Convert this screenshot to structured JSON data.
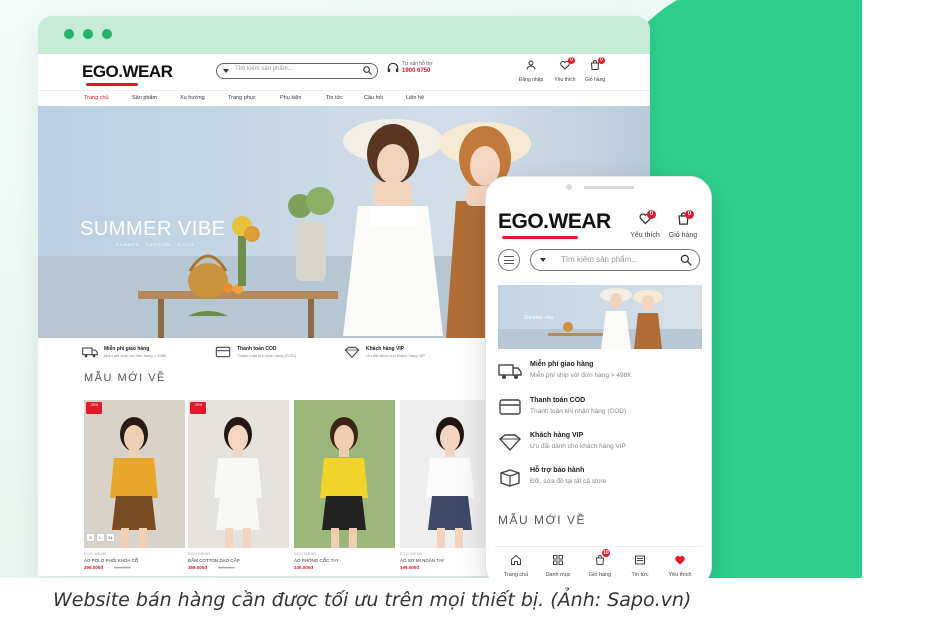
{
  "colors": {
    "brand_green": "#2ecf8d",
    "accent_red": "#e01a2b",
    "chrome_green": "#c6ecd8"
  },
  "desktop": {
    "logo": "EGO.WEAR",
    "search_placeholder": "Tìm kiếm sản phẩm...",
    "hotline_label": "Tư vấn hỗ trợ",
    "hotline_number": "1900 6750",
    "actions": [
      {
        "label": "Đăng nhập",
        "icon": "user-icon"
      },
      {
        "label": "Yêu thích",
        "icon": "heart-icon",
        "badge": "0"
      },
      {
        "label": "Giỏ hàng",
        "icon": "bag-icon",
        "badge": "0"
      }
    ],
    "nav": [
      "Trang chủ",
      "Sản phẩm",
      "Xu hướng",
      "Trang phục",
      "Phụ kiện",
      "Tin tức",
      "Câu hỏi",
      "Liên hệ"
    ],
    "hero": {
      "title": "SUMMER VIBE",
      "subtitle": "SUMMER · FASHION · STYLE"
    },
    "services": [
      {
        "title": "Miễn phí giao hàng",
        "desc": "Miễn phí ship với đơn hàng > 498K",
        "icon": "truck-icon"
      },
      {
        "title": "Thanh toán COD",
        "desc": "Thanh toán khi nhận hàng (COD)",
        "icon": "card-icon"
      },
      {
        "title": "Khách hàng VIP",
        "desc": "Ưu đãi dành cho khách hàng VIP",
        "icon": "diamond-icon"
      }
    ],
    "section_title": "MẪU MỚI VỀ",
    "products": [
      {
        "tag": "-20%",
        "brand": "EGO WEAR",
        "name": "ÁO POLO PHỐI KHÓA CỔ",
        "price": "299.000đ",
        "old_price": "399.000đ",
        "sizes": [
          "S",
          "L",
          "XL"
        ],
        "top": "#e8a72a",
        "bottom": "#7a4a22",
        "skin": "#f0cfb4",
        "hair": "#2a1a12",
        "bg": "#d9d2c8"
      },
      {
        "tag": "-20%",
        "brand": "EGO WEAR",
        "name": "ĐẦM COTTON DẠO CẤP",
        "price": "369.000đ",
        "old_price": "469.000đ",
        "sizes": [],
        "top": "#f7f7f5",
        "bottom": "#f7f7f5",
        "skin": "#f3d6c0",
        "hair": "#241712",
        "bg": "#e6e3df"
      },
      {
        "tag": "",
        "brand": "EGO WEAR",
        "name": "ÁO PHÔNG CỔC TAY",
        "price": "249.000đ",
        "old_price": "",
        "sizes": [],
        "top": "#f2d52a",
        "bottom": "#222222",
        "skin": "#f0cdb0",
        "hair": "#3a2416",
        "bg": "#9bb77a"
      },
      {
        "tag": "",
        "brand": "EGO WEAR",
        "name": "ÁO SƠ MI NGẮN TAY",
        "price": "199.000đ",
        "old_price": "",
        "sizes": [],
        "top": "#fafafa",
        "bottom": "#3b4a66",
        "skin": "#f2d4bf",
        "hair": "#1f1410",
        "bg": "#eeeeee"
      }
    ]
  },
  "mobile": {
    "logo": "EGO.WEAR",
    "actions": [
      {
        "label": "Yêu thích",
        "icon": "heart-icon",
        "badge": "0"
      },
      {
        "label": "Giỏ hàng",
        "icon": "bag-icon",
        "badge": "0"
      }
    ],
    "search_placeholder": "Tìm kiếm sản phẩm...",
    "banner_title": "Summer vibe",
    "services": [
      {
        "title": "Miễn phí giao hàng",
        "desc": "Miễn phí ship với đơn hàng > 498K",
        "icon": "truck-icon"
      },
      {
        "title": "Thanh toán COD",
        "desc": "Thanh toán khi nhận hàng (COD)",
        "icon": "card-icon"
      },
      {
        "title": "Khách hàng VIP",
        "desc": "Ưu đãi dành cho khách hàng VIP",
        "icon": "diamond-icon"
      },
      {
        "title": "Hỗ trợ bảo hành",
        "desc": "Đổi, sửa đồ tại tất cả store",
        "icon": "box-icon"
      }
    ],
    "section_title": "MẪU MỚI VỀ",
    "tabbar": [
      {
        "label": "Trang chủ",
        "icon": "home-icon"
      },
      {
        "label": "Danh mục",
        "icon": "grid-icon"
      },
      {
        "label": "Giỏ hàng",
        "icon": "bag-icon",
        "badge": "10"
      },
      {
        "label": "Tin tức",
        "icon": "news-icon"
      },
      {
        "label": "Yêu thích",
        "icon": "heart-icon"
      }
    ]
  },
  "caption": "Website bán hàng cần được tối ưu trên mọi thiết bị. (Ảnh: Sapo.vn)"
}
